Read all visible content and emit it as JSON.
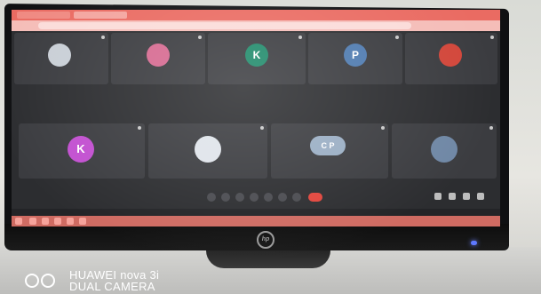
{
  "meeting": {
    "participants_row1": [
      {
        "name": "",
        "initial": "",
        "color": "#c9cfd6",
        "kind": "photo"
      },
      {
        "name": "",
        "initial": "",
        "color": "#d66a91",
        "kind": "photo"
      },
      {
        "name": "",
        "initial": "K",
        "color": "#1f8a6a",
        "kind": "letter"
      },
      {
        "name": "",
        "initial": "P",
        "color": "#4f7bb0",
        "kind": "letter"
      },
      {
        "name": "",
        "initial": "",
        "color": "#d2463a",
        "kind": "photo"
      }
    ],
    "participants_row2": [
      {
        "name": "",
        "initial": "K",
        "color": "#c24fd0",
        "kind": "letter"
      },
      {
        "name": "",
        "initial": "",
        "color": "#dfe4ea",
        "kind": "photo"
      },
      {
        "name": "",
        "initial": "C P",
        "color": "#9aaec4",
        "kind": "group"
      },
      {
        "name": "",
        "initial": "",
        "color": "#6f87a5",
        "kind": "photo"
      }
    ],
    "meeting_info": "",
    "colors": {
      "end_call": "#e2453c",
      "browser": "#ea6b62"
    }
  },
  "watermark": {
    "line1": "HUAWEI nova 3i",
    "line2": "DUAL CAMERA"
  },
  "brand_logo": "hp"
}
